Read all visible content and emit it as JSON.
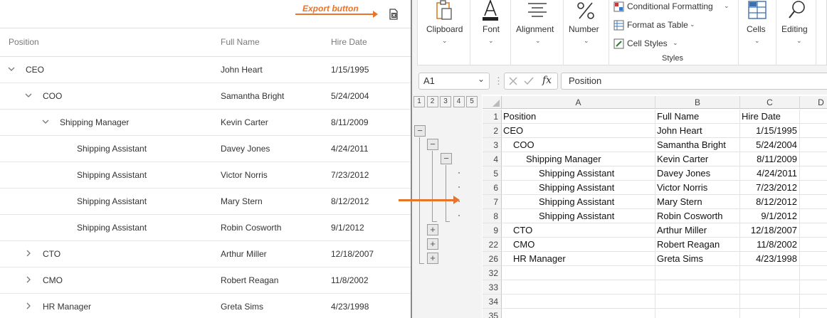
{
  "annotation": {
    "export_label": "Export button"
  },
  "tree": {
    "columns": [
      "Position",
      "Full Name",
      "Hire Date"
    ],
    "rows": [
      {
        "position": "CEO",
        "name": "John Heart",
        "date": "1/15/1995"
      },
      {
        "position": "COO",
        "name": "Samantha Bright",
        "date": "5/24/2004"
      },
      {
        "position": "Shipping Manager",
        "name": "Kevin Carter",
        "date": "8/11/2009"
      },
      {
        "position": "Shipping Assistant",
        "name": "Davey Jones",
        "date": "4/24/2011"
      },
      {
        "position": "Shipping Assistant",
        "name": "Victor Norris",
        "date": "7/23/2012"
      },
      {
        "position": "Shipping Assistant",
        "name": "Mary Stern",
        "date": "8/12/2012"
      },
      {
        "position": "Shipping Assistant",
        "name": "Robin Cosworth",
        "date": "9/1/2012"
      },
      {
        "position": "CTO",
        "name": "Arthur Miller",
        "date": "12/18/2007"
      },
      {
        "position": "CMO",
        "name": "Robert Reagan",
        "date": "11/8/2002"
      },
      {
        "position": "HR Manager",
        "name": "Greta Sims",
        "date": "4/23/1998"
      }
    ]
  },
  "excel": {
    "ribbon": {
      "clipboard": "Clipboard",
      "font": "Font",
      "alignment": "Alignment",
      "number": "Number",
      "conditional_formatting": "Conditional Formatting",
      "format_as_table": "Format as Table",
      "cell_styles": "Cell Styles",
      "styles_group": "Styles",
      "cells": "Cells",
      "editing": "Editing"
    },
    "name_box": "A1",
    "formula": "Position",
    "fx": "fx",
    "outline_levels": [
      "1",
      "2",
      "3",
      "4",
      "5"
    ],
    "columns": [
      "A",
      "B",
      "C",
      "D"
    ],
    "rows": [
      {
        "num": "1",
        "a": "Position",
        "b": "Full Name",
        "c": "Hire Date"
      },
      {
        "num": "2",
        "a": "CEO",
        "b": "John Heart",
        "c": "1/15/1995"
      },
      {
        "num": "3",
        "a": "COO",
        "b": "Samantha Bright",
        "c": "5/24/2004"
      },
      {
        "num": "4",
        "a": "Shipping Manager",
        "b": "Kevin Carter",
        "c": "8/11/2009"
      },
      {
        "num": "5",
        "a": "Shipping Assistant",
        "b": "Davey Jones",
        "c": "4/24/2011"
      },
      {
        "num": "6",
        "a": "Shipping Assistant",
        "b": "Victor Norris",
        "c": "7/23/2012"
      },
      {
        "num": "7",
        "a": "Shipping Assistant",
        "b": "Mary Stern",
        "c": "8/12/2012"
      },
      {
        "num": "8",
        "a": "Shipping Assistant",
        "b": "Robin Cosworth",
        "c": "9/1/2012"
      },
      {
        "num": "9",
        "a": "CTO",
        "b": "Arthur Miller",
        "c": "12/18/2007"
      },
      {
        "num": "22",
        "a": "CMO",
        "b": "Robert Reagan",
        "c": "11/8/2002"
      },
      {
        "num": "26",
        "a": "HR Manager",
        "b": "Greta Sims",
        "c": "4/23/1998"
      },
      {
        "num": "32",
        "a": "",
        "b": "",
        "c": ""
      },
      {
        "num": "33",
        "a": "",
        "b": "",
        "c": ""
      },
      {
        "num": "34",
        "a": "",
        "b": "",
        "c": ""
      },
      {
        "num": "35",
        "a": "",
        "b": "",
        "c": ""
      }
    ]
  },
  "colors": {
    "accent_arrow": "#e8742a"
  }
}
